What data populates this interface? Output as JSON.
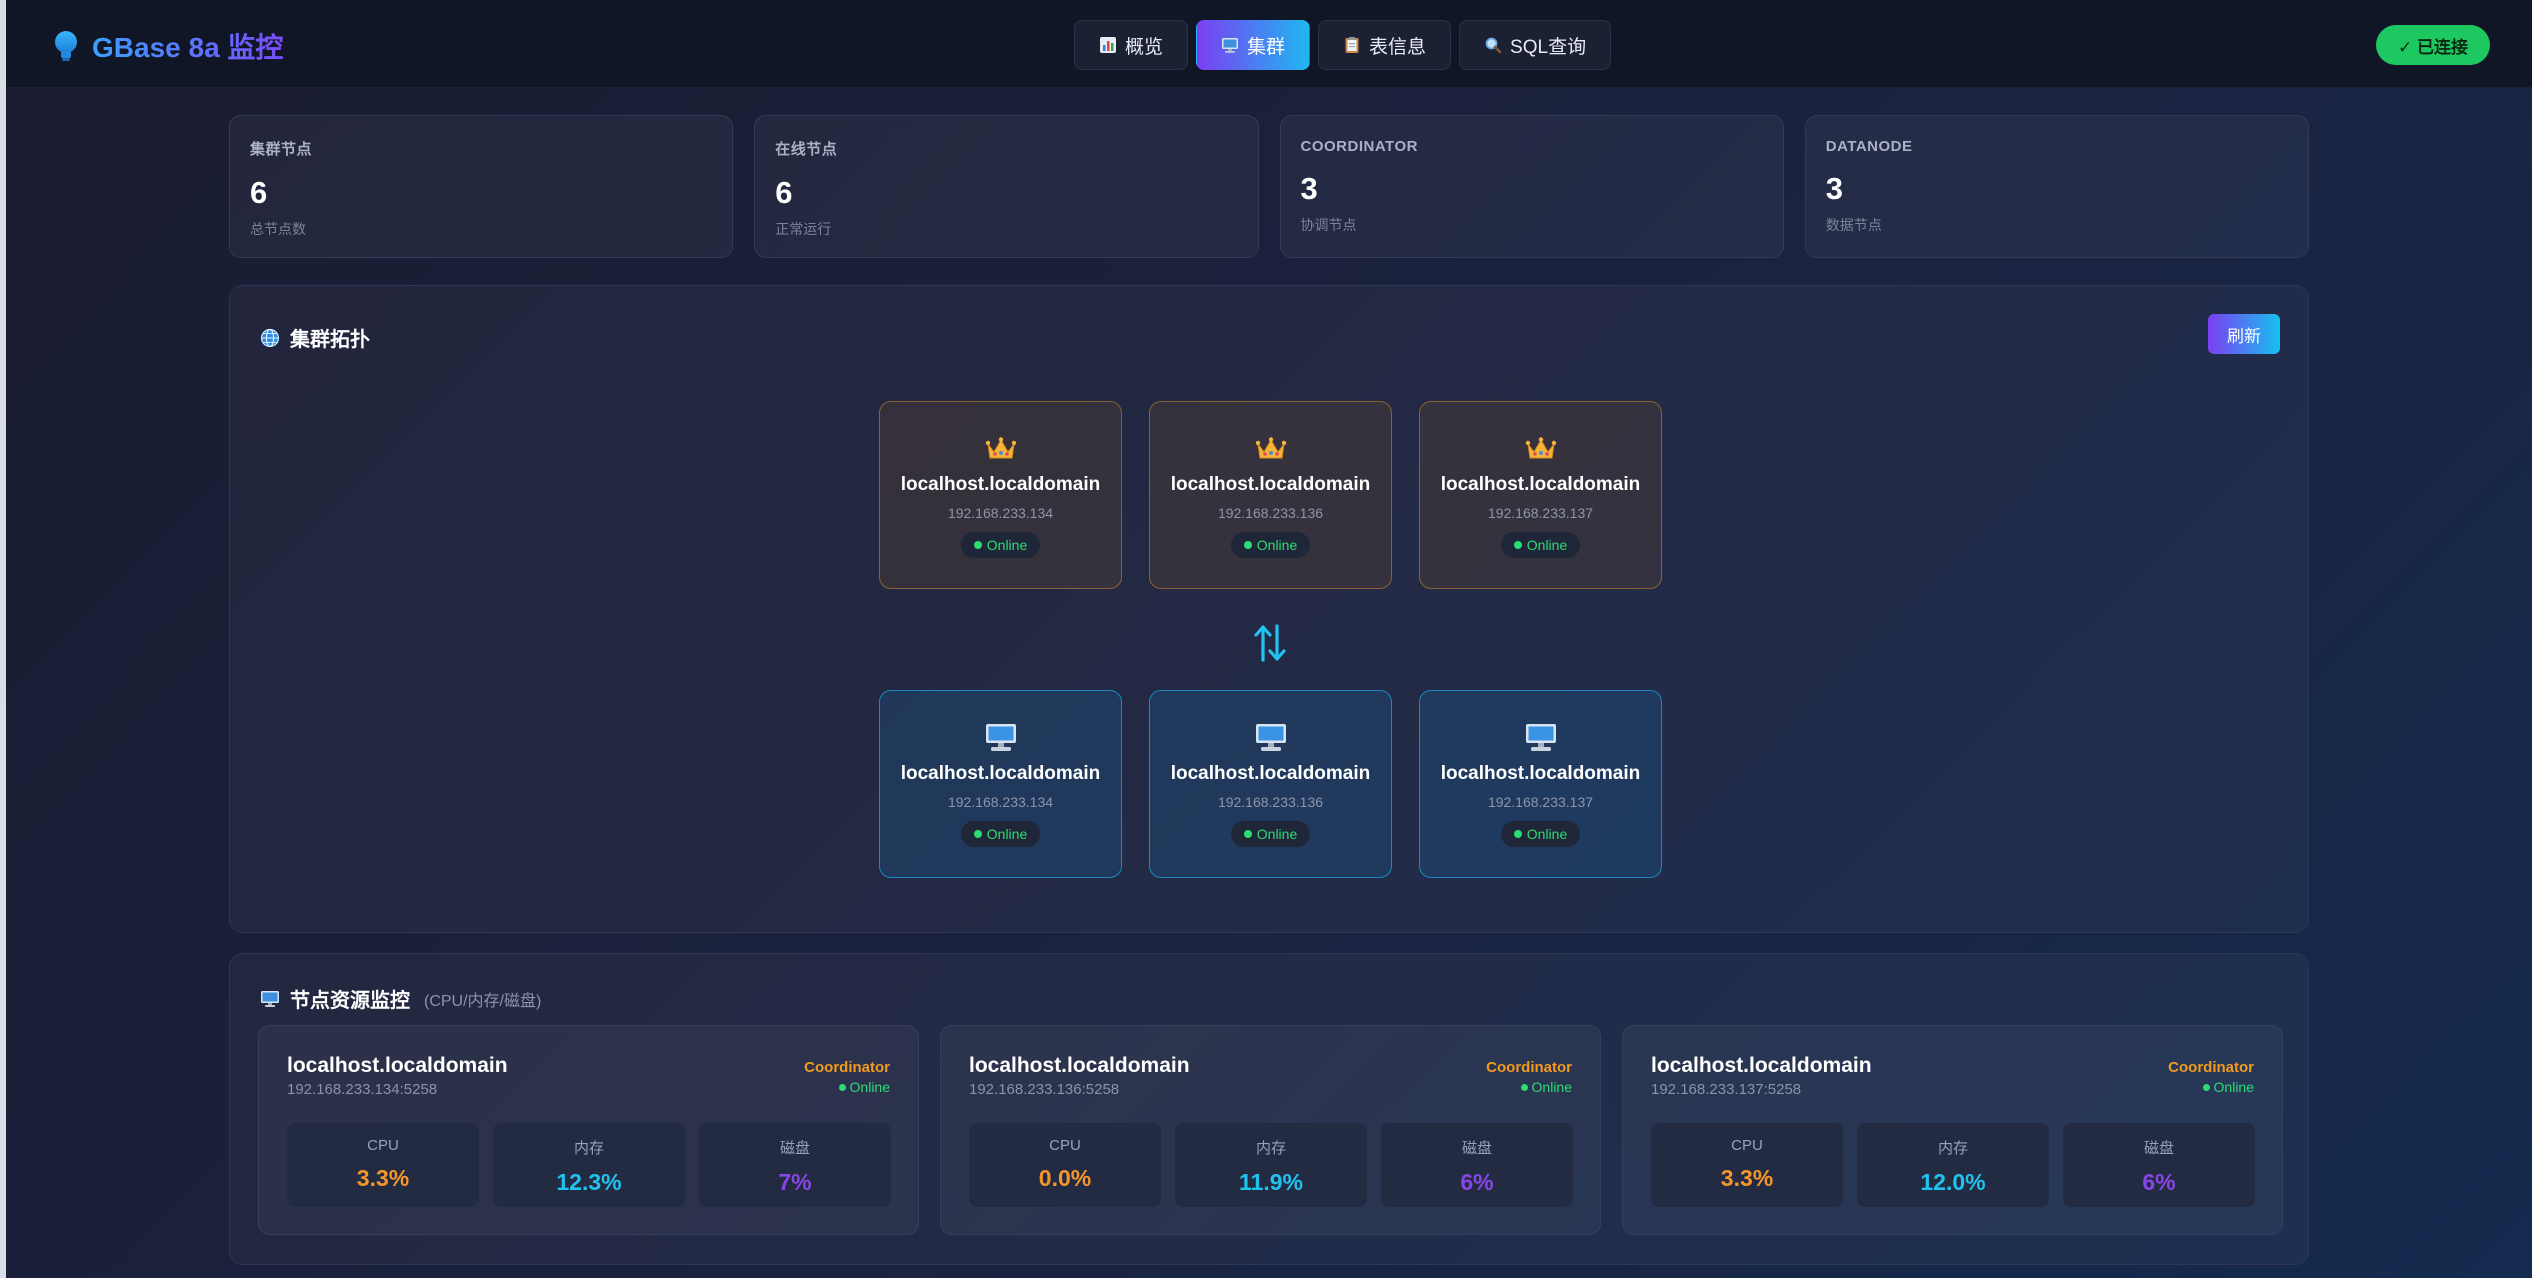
{
  "header": {
    "brand": "GBase 8a 监控",
    "tabs": [
      {
        "label": "概览",
        "icon": "bar-chart-icon",
        "active": false
      },
      {
        "label": "集群",
        "icon": "monitor-icon",
        "active": true
      },
      {
        "label": "表信息",
        "icon": "clipboard-icon",
        "active": false
      },
      {
        "label": "SQL查询",
        "icon": "magnifier-icon",
        "active": false
      }
    ],
    "connection": "✓ 已连接"
  },
  "stats": [
    {
      "label": "集群节点",
      "value": "6",
      "sub": "总节点数"
    },
    {
      "label": "在线节点",
      "value": "6",
      "sub": "正常运行"
    },
    {
      "label": "COORDINATOR",
      "value": "3",
      "sub": "协调节点"
    },
    {
      "label": "DATANODE",
      "value": "3",
      "sub": "数据节点"
    }
  ],
  "topology": {
    "title": "集群拓扑",
    "refresh_label": "刷新",
    "coordinators": [
      {
        "host": "localhost.localdomain",
        "ip": "192.168.233.134",
        "status": "Online"
      },
      {
        "host": "localhost.localdomain",
        "ip": "192.168.233.136",
        "status": "Online"
      },
      {
        "host": "localhost.localdomain",
        "ip": "192.168.233.137",
        "status": "Online"
      }
    ],
    "datanodes": [
      {
        "host": "localhost.localdomain",
        "ip": "192.168.233.134",
        "status": "Online"
      },
      {
        "host": "localhost.localdomain",
        "ip": "192.168.233.136",
        "status": "Online"
      },
      {
        "host": "localhost.localdomain",
        "ip": "192.168.233.137",
        "status": "Online"
      }
    ]
  },
  "resources": {
    "title": "节点资源监控",
    "subtitle": "(CPU/内存/磁盘)",
    "nodes": [
      {
        "host": "localhost.localdomain",
        "addr": "192.168.233.134:5258",
        "role": "Coordinator",
        "status": "Online",
        "cpu_label": "CPU",
        "cpu": "3.3%",
        "mem_label": "内存",
        "mem": "12.3%",
        "disk_label": "磁盘",
        "disk": "7%"
      },
      {
        "host": "localhost.localdomain",
        "addr": "192.168.233.136:5258",
        "role": "Coordinator",
        "status": "Online",
        "cpu_label": "CPU",
        "cpu": "0.0%",
        "mem_label": "内存",
        "mem": "11.9%",
        "disk_label": "磁盘",
        "disk": "6%"
      },
      {
        "host": "localhost.localdomain",
        "addr": "192.168.233.137:5258",
        "role": "Coordinator",
        "status": "Online",
        "cpu_label": "CPU",
        "cpu": "3.3%",
        "mem_label": "内存",
        "mem": "12.0%",
        "disk_label": "磁盘",
        "disk": "6%"
      }
    ]
  },
  "colors": {
    "accent_start": "#7b3ff2",
    "accent_end": "#1fb7f0",
    "online": "#2ddc74",
    "coordinator": "#f29b1e",
    "cpu": "#f5962a",
    "memory": "#20c3ef",
    "disk": "#8a45e8"
  }
}
